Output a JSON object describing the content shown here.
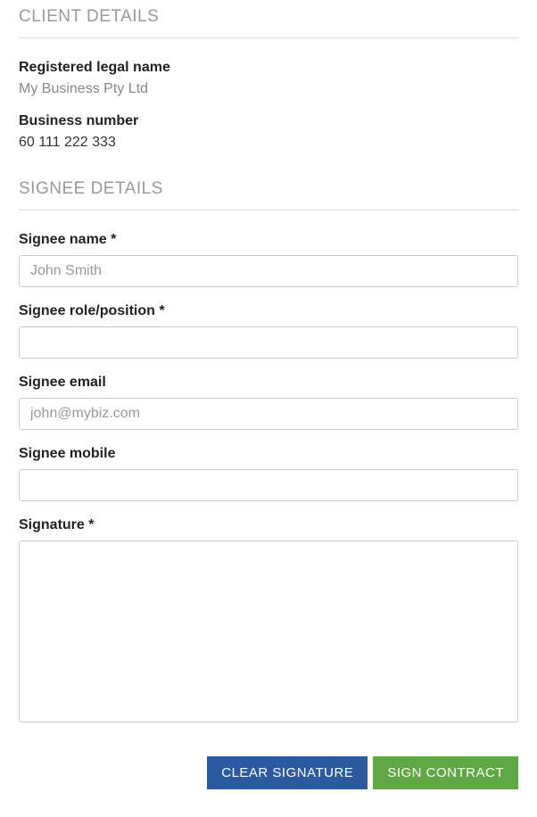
{
  "sections": {
    "client": {
      "header": "CLIENT DETAILS",
      "legal_name_label": "Registered legal name",
      "legal_name_value": "My Business Pty Ltd",
      "business_number_label": "Business number",
      "business_number_value": "60 111 222 333"
    },
    "signee": {
      "header": "SIGNEE DETAILS",
      "name_label": "Signee name *",
      "name_placeholder": "John Smith",
      "name_value": "",
      "role_label": "Signee role/position *",
      "role_value": "",
      "email_label": "Signee email",
      "email_placeholder": "john@mybiz.com",
      "email_value": "",
      "mobile_label": "Signee mobile",
      "mobile_value": "",
      "signature_label": "Signature *"
    }
  },
  "buttons": {
    "clear": "CLEAR SIGNATURE",
    "sign": "SIGN CONTRACT"
  },
  "colors": {
    "clear_button": "#2c5aa0",
    "sign_button": "#5fa845",
    "header_text": "#999",
    "border": "#ccc"
  }
}
